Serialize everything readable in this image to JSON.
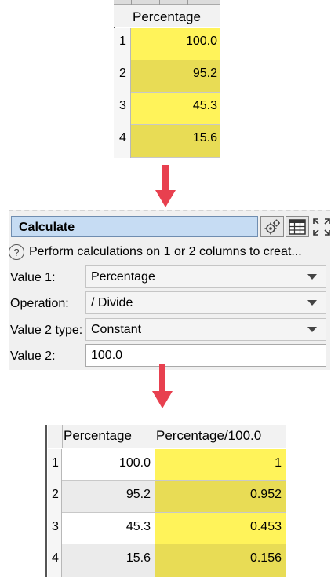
{
  "colors": {
    "yellow_bright": "#fff35a",
    "yellow_dark": "#e8dc55",
    "gray_row": "#ebebeb",
    "white_row": "#ffffff",
    "arrow": "#e8404f",
    "title_bg": "#c6dcf3"
  },
  "top_table": {
    "header": "Percentage",
    "rows": [
      {
        "num": "1",
        "value": "100.0"
      },
      {
        "num": "2",
        "value": "95.2"
      },
      {
        "num": "3",
        "value": "45.3"
      },
      {
        "num": "4",
        "value": "15.6"
      }
    ]
  },
  "calculate": {
    "title": "Calculate",
    "buttons": [
      "settings-icon",
      "table-icon",
      "maximize-icon"
    ],
    "help_icon_glyph": "?",
    "help_text": "Perform calculations on 1 or 2 columns to creat...",
    "value1": {
      "label": "Value 1:",
      "value": "Percentage"
    },
    "operation": {
      "label": "Operation:",
      "value": "/ Divide"
    },
    "value2_type": {
      "label": "Value 2 type:",
      "value": "Constant"
    },
    "value2": {
      "label": "Value 2:",
      "value": "100.0"
    }
  },
  "bottom_table": {
    "headers": [
      "Percentage",
      "Percentage/100.0"
    ],
    "rows": [
      {
        "num": "1",
        "percentage": "100.0",
        "result": "1"
      },
      {
        "num": "2",
        "percentage": "95.2",
        "result": "0.952"
      },
      {
        "num": "3",
        "percentage": "45.3",
        "result": "0.453"
      },
      {
        "num": "4",
        "percentage": "15.6",
        "result": "0.156"
      }
    ]
  }
}
